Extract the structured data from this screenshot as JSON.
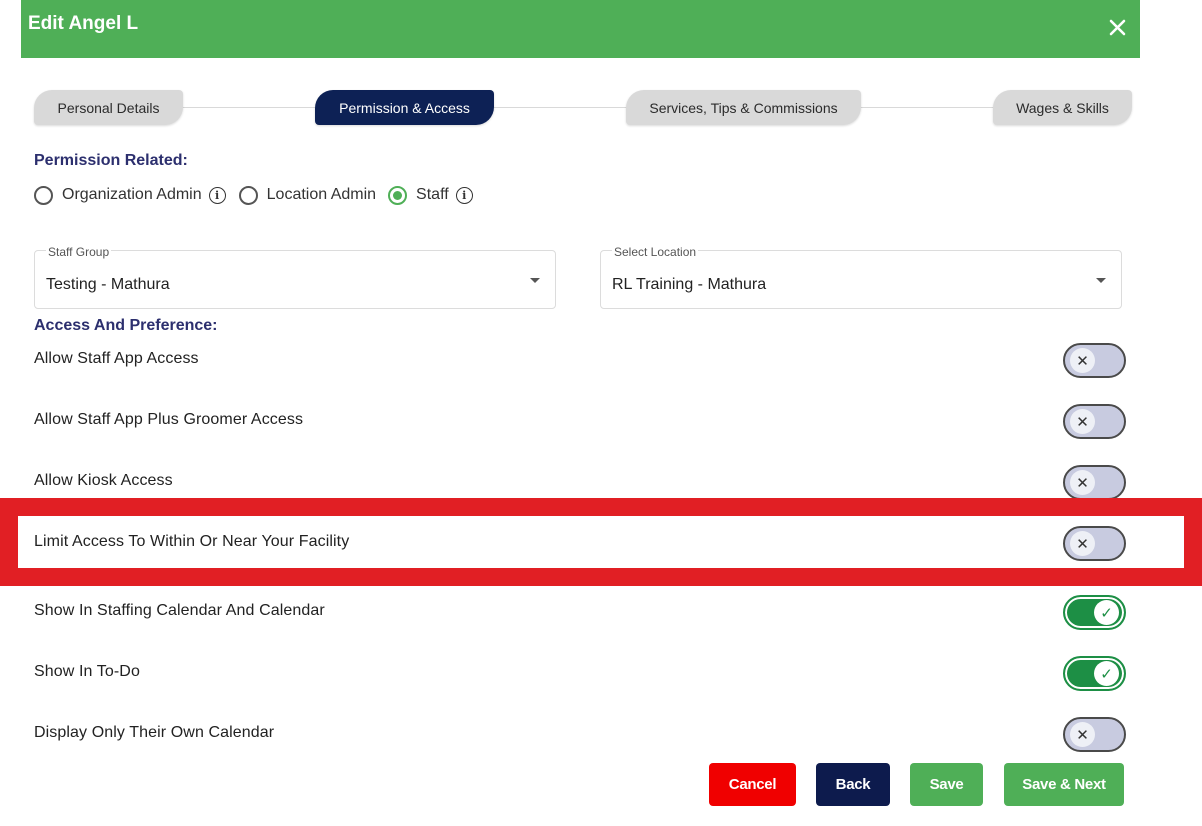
{
  "header": {
    "title": "Edit Angel L",
    "close_icon": "close-icon"
  },
  "tabs": [
    {
      "label": "Personal Details",
      "active": false
    },
    {
      "label": "Permission & Access",
      "active": true
    },
    {
      "label": "Services, Tips & Commissions",
      "active": false
    },
    {
      "label": "Wages & Skills",
      "active": false
    }
  ],
  "permission": {
    "title": "Permission Related:",
    "options": [
      {
        "label": "Organization Admin",
        "checked": false,
        "info": true
      },
      {
        "label": "Location Admin",
        "checked": false,
        "info": false
      },
      {
        "label": "Staff",
        "checked": true,
        "info": true
      }
    ]
  },
  "staff_group": {
    "label": "Staff Group",
    "value": "Testing - Mathura"
  },
  "location": {
    "label": "Select Location",
    "value": "RL Training - Mathura"
  },
  "access": {
    "title": "Access And Preference:",
    "items": [
      {
        "label": "Allow Staff App Access",
        "on": false
      },
      {
        "label": "Allow Staff App Plus Groomer Access",
        "on": false
      },
      {
        "label": "Allow Kiosk Access",
        "on": false
      },
      {
        "label": "Limit Access To Within Or Near Your Facility",
        "on": false,
        "highlighted": true
      },
      {
        "label": "Show In Staffing Calendar And Calendar",
        "on": true
      },
      {
        "label": "Show In To-Do",
        "on": true
      },
      {
        "label": "Display Only Their Own Calendar",
        "on": false
      }
    ]
  },
  "buttons": {
    "cancel": "Cancel",
    "back": "Back",
    "save": "Save",
    "save_next": "Save & Next"
  },
  "colors": {
    "header_green": "#4faf57",
    "tab_active": "#0d2155",
    "cancel_red": "#f00000",
    "back_navy": "#0d1b4d",
    "save_green": "#4faf57",
    "highlight_red": "#e11f24"
  }
}
